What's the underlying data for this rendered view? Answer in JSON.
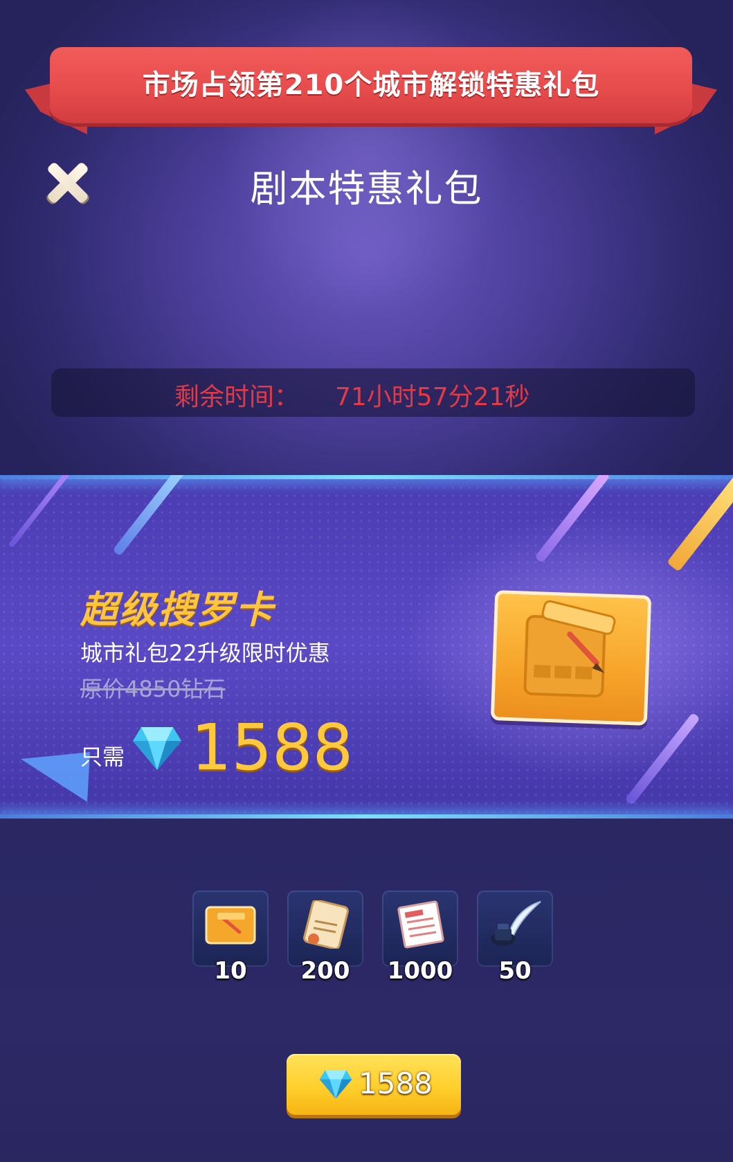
{
  "ribbon": {
    "title": "市场占领第210个城市解锁特惠礼包"
  },
  "page": {
    "title": "剧本特惠礼包"
  },
  "timer": {
    "label": "剩余时间：",
    "value": "71小时57分21秒"
  },
  "offer": {
    "name": "超级搜罗卡",
    "subtitle": "城市礼包22升级限时优惠",
    "original_price": "原价4850钻石",
    "need_label": "只需",
    "price": "1588",
    "currency_icon": "diamond-icon"
  },
  "rewards": [
    {
      "icon": "search-card-icon",
      "count": "10"
    },
    {
      "icon": "work-letter-icon",
      "count": "200"
    },
    {
      "icon": "invoice-document-icon",
      "count": "1000"
    },
    {
      "icon": "ink-quill-icon",
      "count": "50"
    }
  ],
  "buy_button": {
    "price": "1588",
    "icon": "diamond-icon"
  },
  "colors": {
    "ribbon": "#e84c4c",
    "timer_text": "#e33a46",
    "accent_gold": "#ffc53d",
    "button_yellow": "#ffcf2c",
    "background": "#3b3385"
  }
}
